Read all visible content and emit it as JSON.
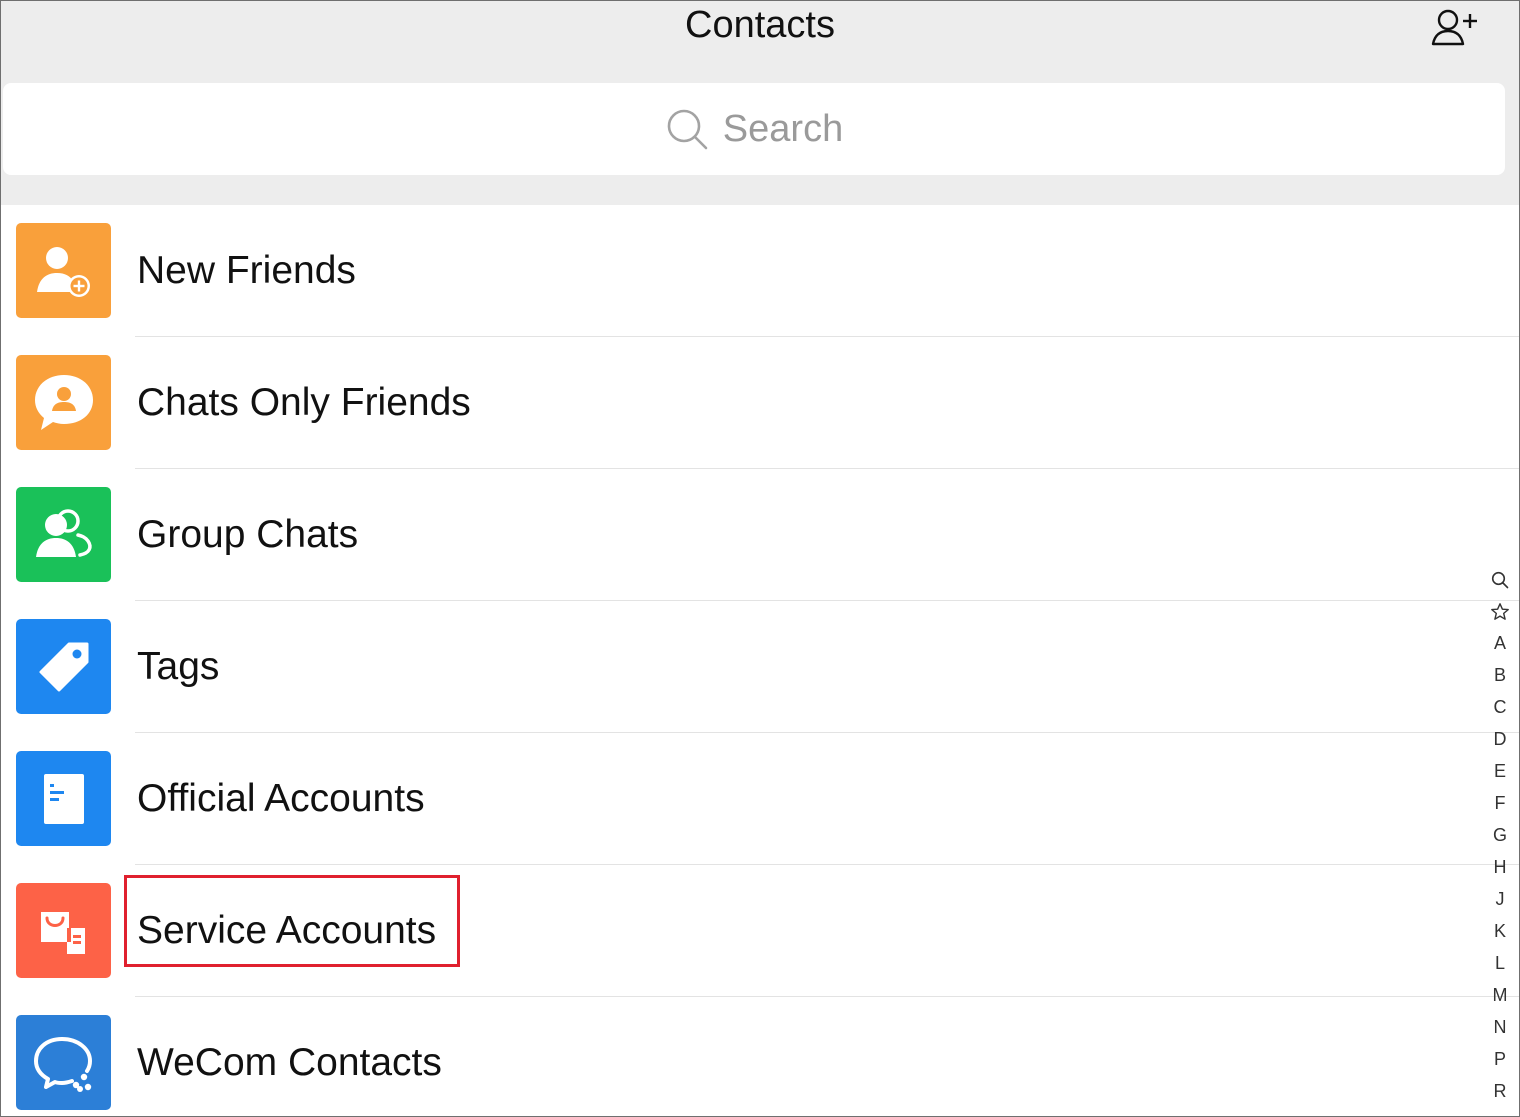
{
  "header": {
    "title": "Contacts",
    "add_icon": "add-contact-icon"
  },
  "search": {
    "placeholder": "Search",
    "icon": "search-icon"
  },
  "contacts_menu": [
    {
      "label": "New Friends",
      "icon": "new-friends-icon",
      "color": "#F9A03B"
    },
    {
      "label": "Chats Only Friends",
      "icon": "chats-only-friends-icon",
      "color": "#F9A03B"
    },
    {
      "label": "Group Chats",
      "icon": "group-chats-icon",
      "color": "#1AC159"
    },
    {
      "label": "Tags",
      "icon": "tag-icon",
      "color": "#1E87F0"
    },
    {
      "label": "Official Accounts",
      "icon": "official-accounts-icon",
      "color": "#1E87F0"
    },
    {
      "label": "Service Accounts",
      "icon": "service-accounts-icon",
      "color": "#FD6247",
      "highlighted": true
    },
    {
      "label": "WeCom Contacts",
      "icon": "wecom-contacts-icon",
      "color": "#2C7FD7"
    }
  ],
  "index_bar": {
    "icons": [
      "search-icon",
      "star-icon"
    ],
    "letters": [
      "A",
      "B",
      "C",
      "D",
      "E",
      "F",
      "G",
      "H",
      "J",
      "K",
      "L",
      "M",
      "N",
      "P",
      "R"
    ]
  },
  "colors": {
    "header_bg": "#EDEDED",
    "highlight_border": "#E0202E"
  }
}
